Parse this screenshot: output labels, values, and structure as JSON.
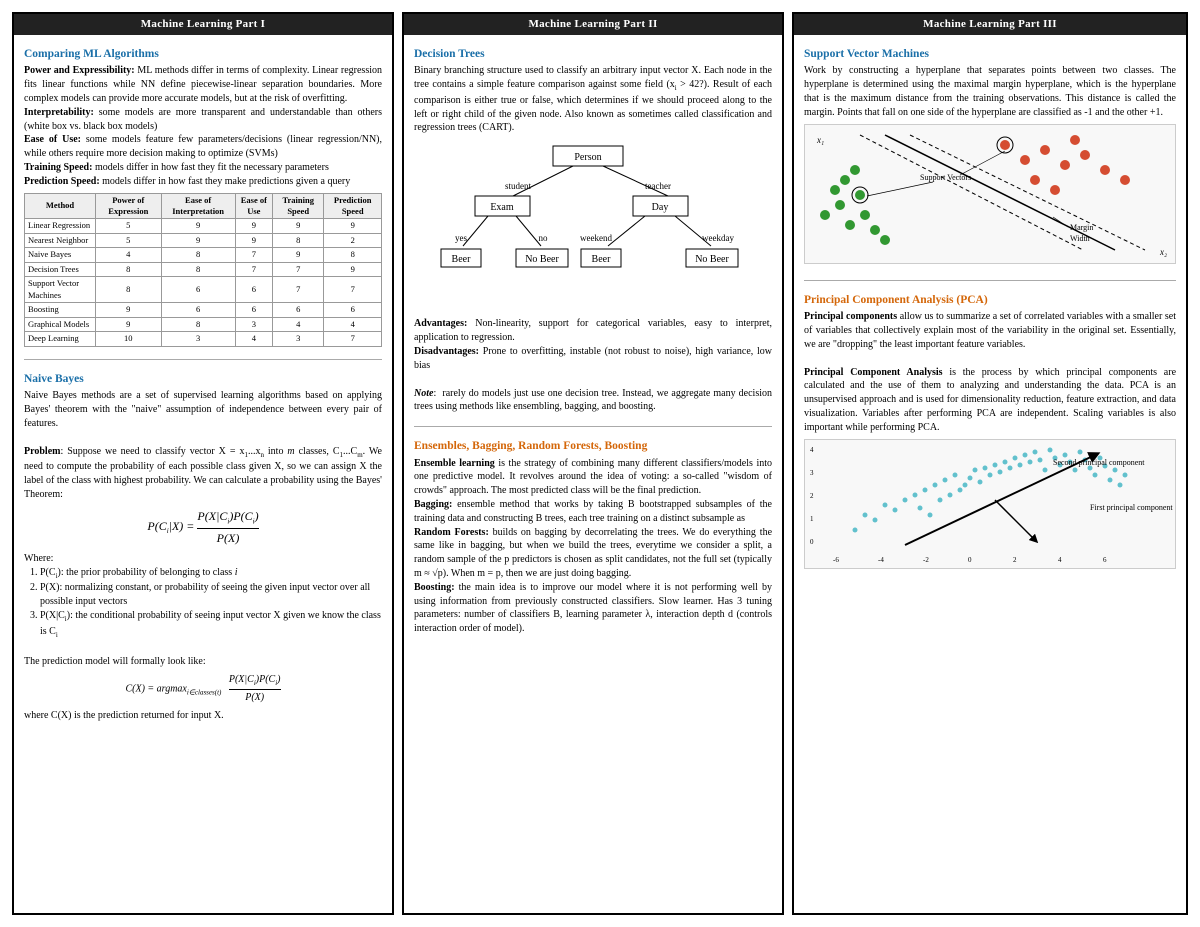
{
  "columns": [
    {
      "header": "Machine Learning Part I",
      "sections": [
        {
          "id": "comparing",
          "title": "Comparing ML Algorithms",
          "title_color": "blue",
          "content": [
            {
              "type": "para",
              "bold": "Power and Expressibility:",
              "text": " ML methods differ in terms of complexity. Linear regression fits linear functions while NN define piecewise-linear separation boundaries. More complex models can provide more accurate models, but at the risk of overfitting."
            },
            {
              "type": "para",
              "bold": "Interpretability:",
              "text": " some models are more transparent and understandable than others (white box vs. black box models)"
            },
            {
              "type": "para",
              "bold": "Ease of Use:",
              "text": " some models feature few parameters/decisions (linear regression/NN), while others require more decision making to optimize (SVMs)"
            },
            {
              "type": "para",
              "bold": "Training Speed:",
              "text": " models differ in how fast they fit the necessary parameters"
            },
            {
              "type": "para",
              "bold": "Prediction Speed:",
              "text": " models differ in how fast they make predictions given a query"
            }
          ],
          "table": {
            "headers": [
              "Method",
              "Power of Expression",
              "Ease of Interpretation",
              "Ease of Use",
              "Training Speed",
              "Prediction Speed"
            ],
            "rows": [
              [
                "Linear Regression",
                "5",
                "9",
                "9",
                "9",
                "9"
              ],
              [
                "Nearest Neighbor",
                "5",
                "9",
                "9",
                "8",
                "2"
              ],
              [
                "Naive Bayes",
                "4",
                "8",
                "7",
                "9",
                "8"
              ],
              [
                "Decision Trees",
                "8",
                "8",
                "7",
                "7",
                "9"
              ],
              [
                "Support Vector Machines",
                "8",
                "6",
                "6",
                "7",
                "7"
              ],
              [
                "Boosting",
                "9",
                "6",
                "6",
                "6",
                "6"
              ],
              [
                "Graphical Models",
                "9",
                "8",
                "3",
                "4",
                "4"
              ],
              [
                "Deep Learning",
                "10",
                "3",
                "4",
                "3",
                "7"
              ]
            ]
          }
        },
        {
          "id": "naive-bayes",
          "title": "Naive Bayes",
          "title_color": "blue",
          "paragraphs": [
            "Naive Bayes methods are a set of supervised learning algorithms based on applying Bayes' theorem with the \"naive\" assumption of independence between every pair of features.",
            "Problem: Suppose we need to classify vector X = x₁...xₙ into m classes, C₁...Cₘ. We need to compute the probability of each possible class given X, so we can assign X the label of the class with highest probability. We can calculate a probability using the Bayes' Theorem:"
          ],
          "formula": "P(Cᵢ|X) = P(X|Cᵢ)P(Cᵢ) / P(X)",
          "where_label": "Where:",
          "where_items": [
            "P(Cᵢ): the prior probability of belonging to class i",
            "P(X): normalizing constant, or probability of seeing the given input vector over all possible input vectors",
            "P(X|Cᵢ): the conditional probability of seeing input vector X given we know the class is Cᵢ"
          ],
          "closing": [
            "The prediction model will formally look like:",
            "C(X) = argmax_{i∈classes(t)}  P(X|Cᵢ)P(Cᵢ) / P(X)",
            "where C(X) is the prediction returned for input X."
          ]
        }
      ]
    },
    {
      "header": "Machine Learning Part II",
      "sections": [
        {
          "id": "decision-trees",
          "title": "Decision Trees",
          "title_color": "blue",
          "intro": "Binary branching structure used to classify an arbitrary input vector X. Each node in the tree contains a simple feature comparison against some field (xᵢ > 42?). Result of each comparison is either true or false, which determines if we should proceed along to the left or right child of the given node. Also known as sometimes called classification and regression trees (CART).",
          "advantages": "Non-linearity, support for categorical variables, easy to interpret, application to regression.",
          "disadvantages": "Prone to overfitting, instable (not robust to noise), high variance, low bias",
          "note": "rarely do models just use one decision tree. Instead, we aggregate many decision trees using methods like ensembling, bagging, and boosting."
        },
        {
          "id": "ensembles",
          "title": "Ensembles, Bagging, Random Forests, Boosting",
          "title_color": "orange",
          "paragraphs": [
            {
              "bold": "Ensemble learning",
              "text": " is the strategy of combining many different classifiers/models into one predictive model. It revolves around the idea of voting: a so-called \"wisdom of crowds\" approach. The most predicted class will be the final prediction."
            },
            {
              "bold": "Bagging:",
              "text": " ensemble method that works by taking B bootstrapped subsamples of the training data and constructing B trees, each tree training on a distinct subsample as"
            },
            {
              "bold": "Random Forests:",
              "text": " builds on bagging by decorrelating the trees. We do everything the same like in bagging, but when we build the trees, everytime we consider a split, a random sample of the p predictors is chosen as split candidates, not the full set (typically m ≈ √p). When m = p, then we are just doing bagging."
            },
            {
              "bold": "Boosting:",
              "text": " the main idea is to improve our model where it is not performing well by using information from previously constructed classifiers. Slow learner. Has 3 tuning parameters: number of classifiers B, learning parameter λ, interaction depth d (controls interaction order of model)."
            }
          ]
        }
      ]
    },
    {
      "header": "Machine Learning Part III",
      "sections": [
        {
          "id": "svm",
          "title": "Support Vector Machines",
          "title_color": "blue",
          "intro": "Work by constructing a hyperplane that separates points between two classes. The hyperplane is determined using the maximal margin hyperplane, which is the hyperplane that is the maximum distance from the training observations. This distance is called the margin. Points that fall on one side of the hyperplane are classified as -1 and the other +1."
        },
        {
          "id": "pca",
          "title": "Principal Component Analysis (PCA)",
          "title_color": "orange",
          "paragraphs": [
            {
              "bold": "Principal components",
              "text": " allow us to summarize a set of correlated variables with a smaller set of variables that collectively explain most of the variability in the original set. Essentially, we are \"dropping\" the least important feature variables."
            },
            {
              "bold": "Principal Component Analysis",
              "text": " is the process by which principal components are calculated and the use of them to analyzing and understanding the data. PCA is an unsupervised approach and is used for dimensionality reduction, feature extraction, and data visualization. Variables after performing PCA are independent. Scaling variables is also important while performing PCA."
            }
          ]
        }
      ]
    }
  ],
  "labels": {
    "col1_header": "Machine Learning Part I",
    "col2_header": "Machine Learning Part II",
    "col3_header": "Machine Learning Part III",
    "comparing_title": "Comparing ML Algorithms",
    "naive_bayes_title": "Naive Bayes",
    "decision_trees_title": "Decision Trees",
    "ensembles_title": "Ensembles, Bagging, Random Forests, Boosting",
    "svm_title": "Support Vector Machines",
    "pca_title": "Principal Component Analysis (PCA)",
    "advantages_label": "Advantages:",
    "disadvantages_label": "Disadvantages:",
    "note_label": "Note:"
  }
}
